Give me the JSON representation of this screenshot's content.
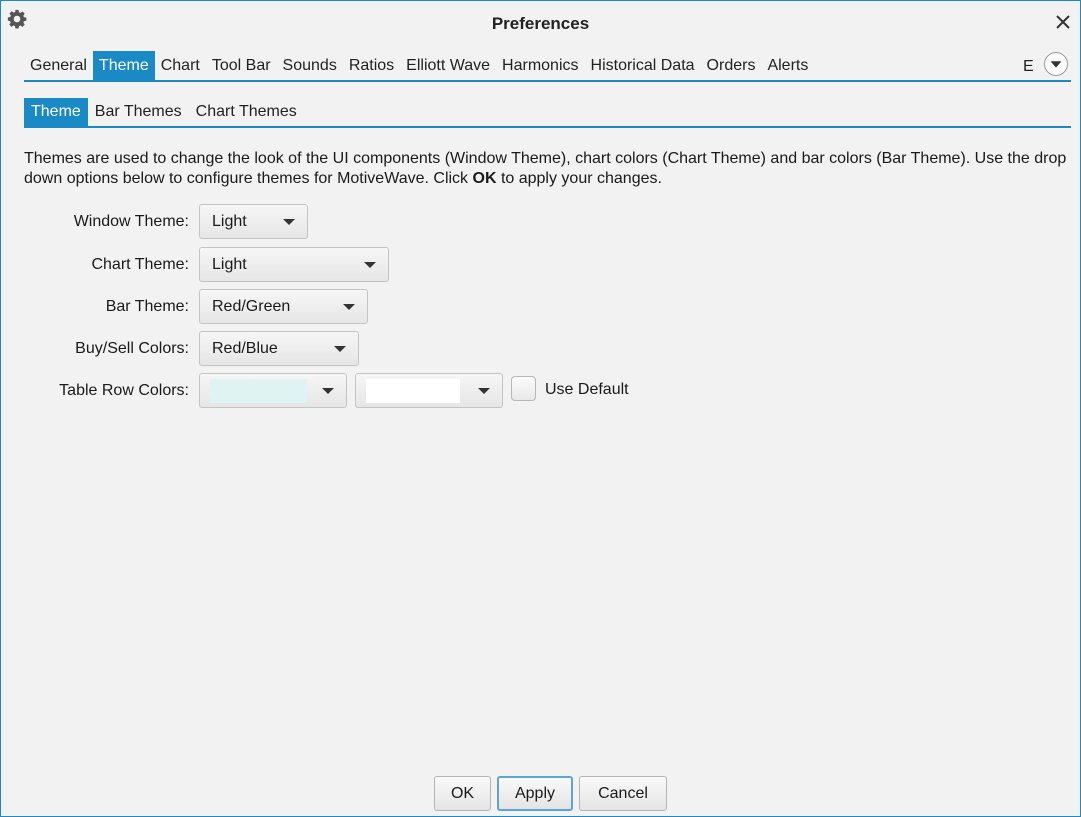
{
  "window": {
    "title": "Preferences",
    "accent": "#1a8ac6"
  },
  "main_tabs": [
    {
      "label": "General",
      "active": false
    },
    {
      "label": "Theme",
      "active": true
    },
    {
      "label": "Chart",
      "active": false
    },
    {
      "label": "Tool Bar",
      "active": false
    },
    {
      "label": "Sounds",
      "active": false
    },
    {
      "label": "Ratios",
      "active": false
    },
    {
      "label": "Elliott Wave",
      "active": false
    },
    {
      "label": "Harmonics",
      "active": false
    },
    {
      "label": "Historical Data",
      "active": false
    },
    {
      "label": "Orders",
      "active": false
    },
    {
      "label": "Alerts",
      "active": false
    }
  ],
  "main_tabs_overflow_label": "E",
  "sub_tabs": [
    {
      "label": "Theme",
      "active": true
    },
    {
      "label": "Bar Themes",
      "active": false
    },
    {
      "label": "Chart Themes",
      "active": false
    }
  ],
  "description": {
    "before": "Themes are used to change the look of the UI components (Window Theme), chart colors (Chart Theme) and bar colors (Bar Theme).  Use the drop down options below to configure themes for MotiveWave.  Click ",
    "bold": "OK",
    "after": " to apply your changes."
  },
  "form": {
    "window_theme": {
      "label": "Window Theme:",
      "value": "Light"
    },
    "chart_theme": {
      "label": "Chart Theme:",
      "value": "Light"
    },
    "bar_theme": {
      "label": "Bar Theme:",
      "value": "Red/Green"
    },
    "buy_sell_colors": {
      "label": "Buy/Sell Colors:",
      "value": "Red/Blue"
    },
    "table_row_colors": {
      "label": "Table Row Colors:",
      "color1": "#dff3f3",
      "color2": "#ffffff",
      "use_default_label": "Use Default",
      "use_default_checked": false
    }
  },
  "buttons": {
    "ok": "OK",
    "apply": "Apply",
    "cancel": "Cancel"
  },
  "icons": {
    "window_icon": "gear-icon",
    "close": "close-icon",
    "tab_menu": "chevron-down-circle-icon"
  }
}
